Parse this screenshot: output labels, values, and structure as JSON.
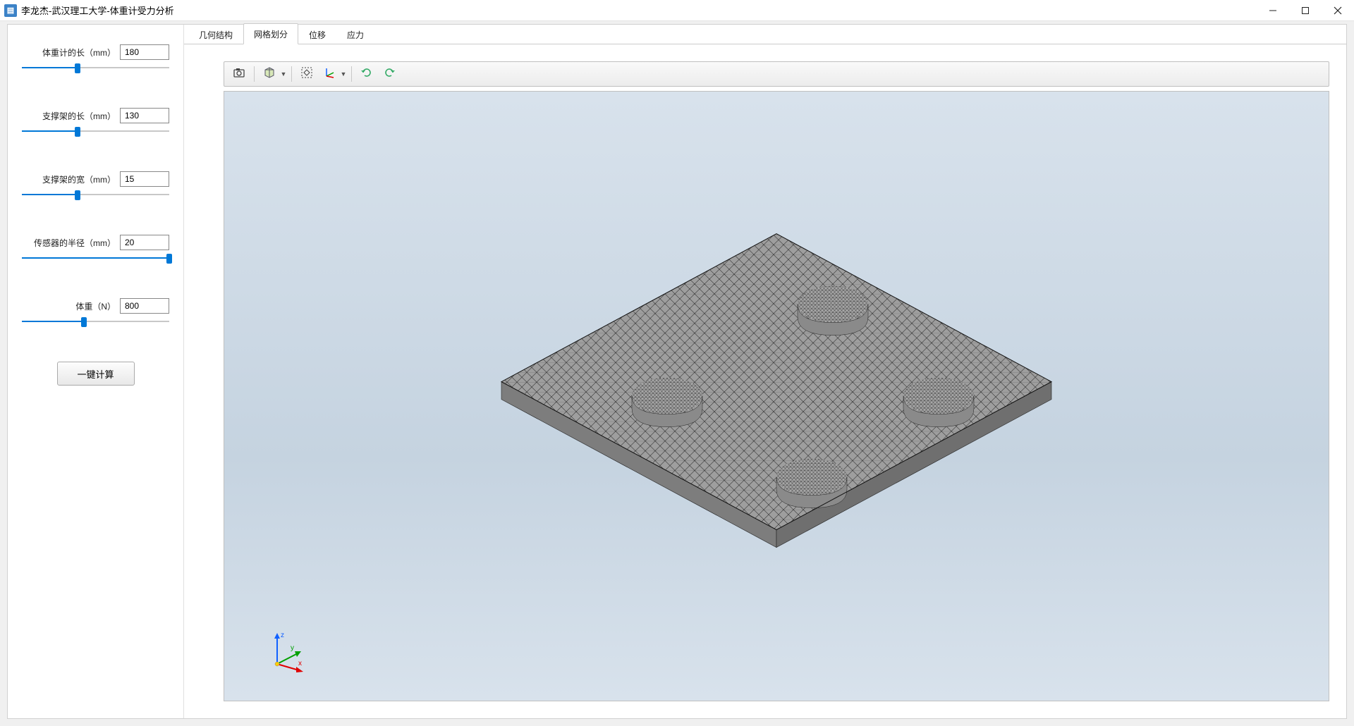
{
  "window": {
    "title": "李龙杰-武汉理工大学-体重计受力分析",
    "app_icon_glyph": "▤"
  },
  "sidebar": {
    "params": [
      {
        "label": "体重计的长（mm）",
        "value": "180",
        "slider_pct": 38
      },
      {
        "label": "支撑架的长（mm）",
        "value": "130",
        "slider_pct": 38
      },
      {
        "label": "支撑架的宽（mm）",
        "value": "15",
        "slider_pct": 38
      },
      {
        "label": "传感器的半径（mm）",
        "value": "20",
        "slider_pct": 100
      },
      {
        "label": "体重（N）",
        "value": "800",
        "slider_pct": 42
      }
    ],
    "compute_label": "一键计算"
  },
  "tabs": [
    {
      "label": "几何结构",
      "active": false
    },
    {
      "label": "网格划分",
      "active": true
    },
    {
      "label": "位移",
      "active": false
    },
    {
      "label": "应力",
      "active": false
    }
  ],
  "toolbar": {
    "icons": [
      {
        "name": "camera-icon"
      },
      {
        "name": "cube-view-icon",
        "dropdown": true
      },
      {
        "name": "fit-view-icon"
      },
      {
        "name": "axes-icon",
        "dropdown": true
      },
      {
        "name": "rotate-cw-icon"
      },
      {
        "name": "rotate-ccw-icon"
      }
    ]
  },
  "triad": {
    "x": "x",
    "y": "y",
    "z": "z"
  }
}
